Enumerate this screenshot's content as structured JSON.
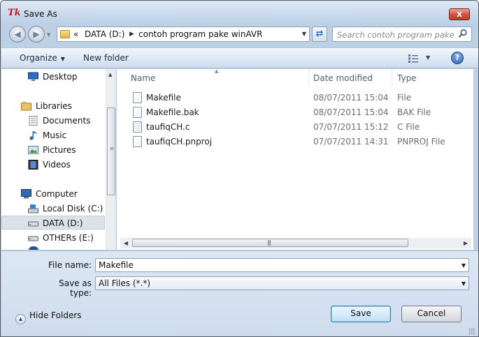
{
  "window": {
    "title": "Save As",
    "title_icon": "Tk",
    "close_glyph": "x"
  },
  "navigation": {
    "back_icon": "back-arrow-icon",
    "forward_icon": "forward-arrow-icon",
    "breadcrumb": [
      "«",
      "DATA (D:)",
      "contoh program pake winAVR"
    ],
    "refresh_icon": "refresh-icon"
  },
  "search": {
    "placeholder": "Search contoh program pake ...",
    "icon": "search-icon"
  },
  "toolbar": {
    "organize_label": "Organize",
    "new_folder_label": "New folder",
    "views_icon": "views-icon",
    "help_label": "?"
  },
  "nav_pane": {
    "items": [
      {
        "label": "Desktop",
        "icon": "desktop-icon"
      },
      {
        "label": "Libraries",
        "icon": "libraries-icon"
      },
      {
        "label": "Documents",
        "icon": "documents-icon"
      },
      {
        "label": "Music",
        "icon": "music-icon"
      },
      {
        "label": "Pictures",
        "icon": "pictures-icon"
      },
      {
        "label": "Videos",
        "icon": "videos-icon"
      },
      {
        "label": "Computer",
        "icon": "computer-icon"
      },
      {
        "label": "Local Disk (C:)",
        "icon": "drive-icon"
      },
      {
        "label": "DATA (D:)",
        "icon": "drive-icon",
        "selected": true
      },
      {
        "label": "OTHERs (E:)",
        "icon": "drive-icon"
      }
    ]
  },
  "file_list": {
    "columns": {
      "name": "Name",
      "date": "Date modified",
      "type": "Type"
    },
    "files": [
      {
        "name": "Makefile",
        "date": "08/07/2011 15:04",
        "type": "File"
      },
      {
        "name": "Makefile.bak",
        "date": "08/07/2011 15:04",
        "type": "BAK File"
      },
      {
        "name": "taufiqCH.c",
        "date": "07/07/2011 15:12",
        "type": "C File"
      },
      {
        "name": "taufiqCH.pnproj",
        "date": "07/07/2011 14:31",
        "type": "PNPROJ File"
      }
    ]
  },
  "form": {
    "file_name_label": "File name:",
    "file_name_value": "Makefile",
    "save_type_label": "Save as type:",
    "save_type_value": "All Files (*.*)"
  },
  "footer": {
    "hide_folders_label": "Hide Folders",
    "save_label": "Save",
    "cancel_label": "Cancel"
  },
  "colors": {
    "chrome": "#bcd0e6",
    "close_button": "#c94a33",
    "selection": "#dbe2ea",
    "default_button": "#bfe0f6"
  }
}
